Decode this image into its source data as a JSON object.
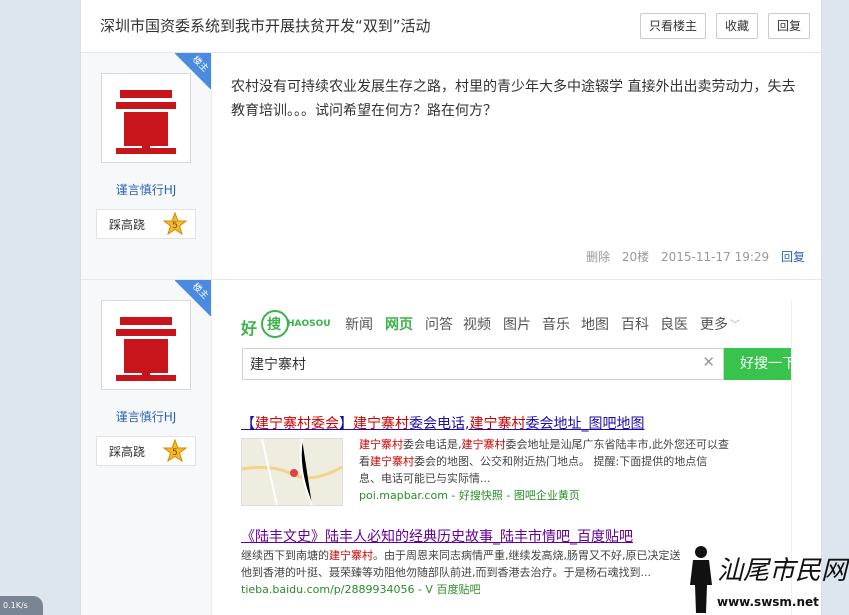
{
  "header": {
    "title": "深圳市国资委系统到我市开展扶贫开发“双到”活动",
    "buttons": {
      "only_op": "只看楼主",
      "favorite": "收藏",
      "reply": "回复"
    }
  },
  "posts": [
    {
      "badge": "楼主",
      "username": "谨言慎行HJ",
      "level_name": "踩高跷",
      "level_num": "5",
      "content": "农村没有可持续农业发展生存之路，村里的青少年大多中途辍学 直接外出出卖劳动力，失去教育培训。。。试问希望在何方？路在何方？",
      "meta": {
        "delete": "删除",
        "floor": "20楼",
        "time": "2015-11-17 19:29",
        "reply": "回复"
      }
    },
    {
      "badge": "楼主",
      "username": "谨言慎行HJ",
      "level_name": "踩高跷",
      "level_num": "5"
    }
  ],
  "search_shot": {
    "logo_a": "好",
    "logo_b": "搜",
    "logo_en": "HAOSOU",
    "tabs": [
      "新闻",
      "网页",
      "问答",
      "视频",
      "图片",
      "音乐",
      "地图",
      "百科",
      "良医",
      "更多"
    ],
    "query": "建宁寨村",
    "clear": "✕",
    "button": "好搜一下",
    "result1": {
      "t1": "【",
      "t2": "建宁寨村委会",
      "t3": "】",
      "t4": "建宁寨村",
      "t5": "委会电话,",
      "t6": "建宁寨村",
      "t7": "委会地址_图吧地图",
      "d1": "建宁寨村",
      "d2": "委会电话是,",
      "d3": "建宁寨村",
      "d4": "委会地址是汕尾广东省陆丰市,此外您还可以查看",
      "d5": "建宁寨村",
      "d6": "委会的地图、公交和附近热门地点。 提醒:下面提供的地点信息、电话可能已与实际情...",
      "url": "poi.mapbar.com - 好搜快照 - 图吧企业黄页"
    },
    "result2": {
      "title": "《陆丰文史》陆丰人必知的经典历史故事_陆丰市情吧_百度贴吧",
      "d1": "继续西下到南塘的",
      "d2": "建宁寨村",
      "d3": "。由于周恩来同志病情严重,继续发高烧,肠胃又不好,原已决定送他到香港的叶挺、聂荣臻等劝阻他勿随部队前进,而到香港去治疗。于是杨石魂找到...",
      "url": "tieba.baidu.com/p/2889934056 - V 百度贴吧"
    }
  },
  "watermark": {
    "text": "汕尾市民网",
    "url": "www.swsm.net"
  },
  "status": {
    "speed": "0.1K/s"
  },
  "colors": {
    "link": "#2d64b3",
    "badge": "#4a8be0",
    "accent_green": "#37c34c",
    "avatar_red": "#c8151b"
  }
}
